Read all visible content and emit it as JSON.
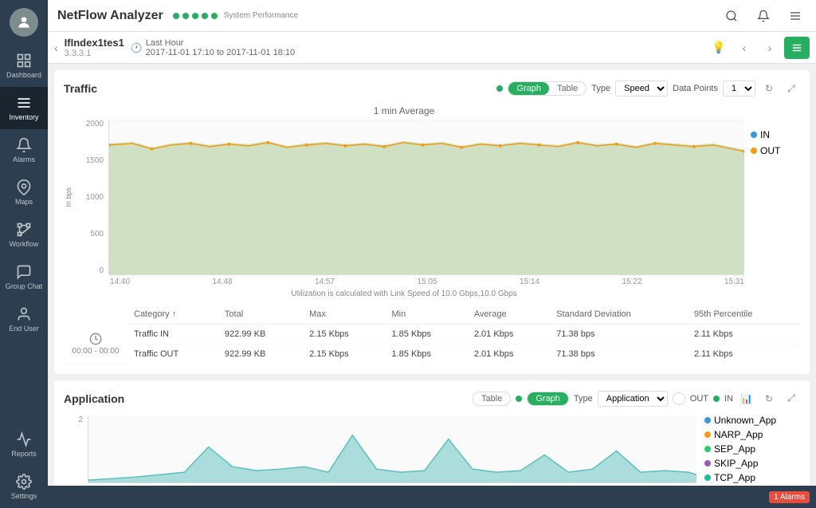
{
  "app": {
    "name": "NetFlow Analyzer",
    "system_label": "System Performance"
  },
  "topbar": {
    "dots": [
      {
        "color": "#27ae60"
      },
      {
        "color": "#27ae60"
      },
      {
        "color": "#27ae60"
      },
      {
        "color": "#27ae60"
      },
      {
        "color": "#27ae60"
      }
    ]
  },
  "navbar": {
    "back_label": "‹",
    "device_name": "IfIndex1tes1",
    "device_ip": "3.3.3.1",
    "time_period": "Last Hour",
    "time_range": "2017-11-01 17:10 to 2017-11-01 18:10"
  },
  "sidebar": {
    "items": [
      {
        "label": "Dashboard",
        "icon": "grid"
      },
      {
        "label": "Inventory",
        "icon": "list"
      },
      {
        "label": "Alarms",
        "icon": "bell"
      },
      {
        "label": "Maps",
        "icon": "map-pin"
      },
      {
        "label": "Workflow",
        "icon": "workflow"
      },
      {
        "label": "Group Chat",
        "icon": "chat"
      },
      {
        "label": "End User",
        "icon": "user"
      }
    ]
  },
  "traffic": {
    "section_title": "Traffic",
    "graph_label": "Graph",
    "table_label": "Table",
    "type_label": "Type",
    "type_value": "Speed",
    "data_points_label": "Data Points",
    "data_points_value": "1",
    "chart_title": "1 min Average",
    "yaxis_label": "In bps",
    "yaxis_values": [
      "2000",
      "1500",
      "1000",
      "500",
      "0"
    ],
    "xaxis_values": [
      "14:40",
      "14:48",
      "14:57",
      "15:05",
      "15:14",
      "15:22",
      "15:31"
    ],
    "chart_note": "Utilization is calculated with Link Speed of 10.0 Gbps,10.0 Gbps",
    "legend": [
      {
        "label": "IN",
        "color": "#3498db"
      },
      {
        "label": "OUT",
        "color": "#f39c12"
      }
    ],
    "table": {
      "columns": [
        "Category",
        "Total",
        "Max",
        "Min",
        "Average",
        "Standard Deviation",
        "95th Percentile"
      ],
      "rows": [
        {
          "category": "Traffic IN",
          "total": "922.99 KB",
          "max": "2.15 Kbps",
          "min": "1.85 Kbps",
          "average": "2.01 Kbps",
          "std_dev": "71.38 bps",
          "percentile_95": "2.11 Kbps"
        },
        {
          "category": "Traffic OUT",
          "total": "922.99 KB",
          "max": "2.15 Kbps",
          "min": "1.85 Kbps",
          "average": "2.01 Kbps",
          "std_dev": "71.38 bps",
          "percentile_95": "2.11 Kbps"
        }
      ],
      "time_label": "00:00 - 00:00"
    }
  },
  "application": {
    "section_title": "Application",
    "graph_label": "Graph",
    "table_label": "Table",
    "type_label": "Type",
    "type_value": "Application",
    "out_label": "OUT",
    "in_label": "IN",
    "legend": [
      {
        "label": "Unknown_App",
        "color": "#3498db"
      },
      {
        "label": "NARP_App",
        "color": "#f39c12"
      },
      {
        "label": "SEP_App",
        "color": "#2ecc71"
      },
      {
        "label": "SKIP_App",
        "color": "#9b59b6"
      },
      {
        "label": "TCP_App",
        "color": "#1abc9c"
      }
    ],
    "yaxis_values": [
      "2",
      ""
    ]
  },
  "alarms": {
    "count": "1",
    "label": "Alarms"
  }
}
